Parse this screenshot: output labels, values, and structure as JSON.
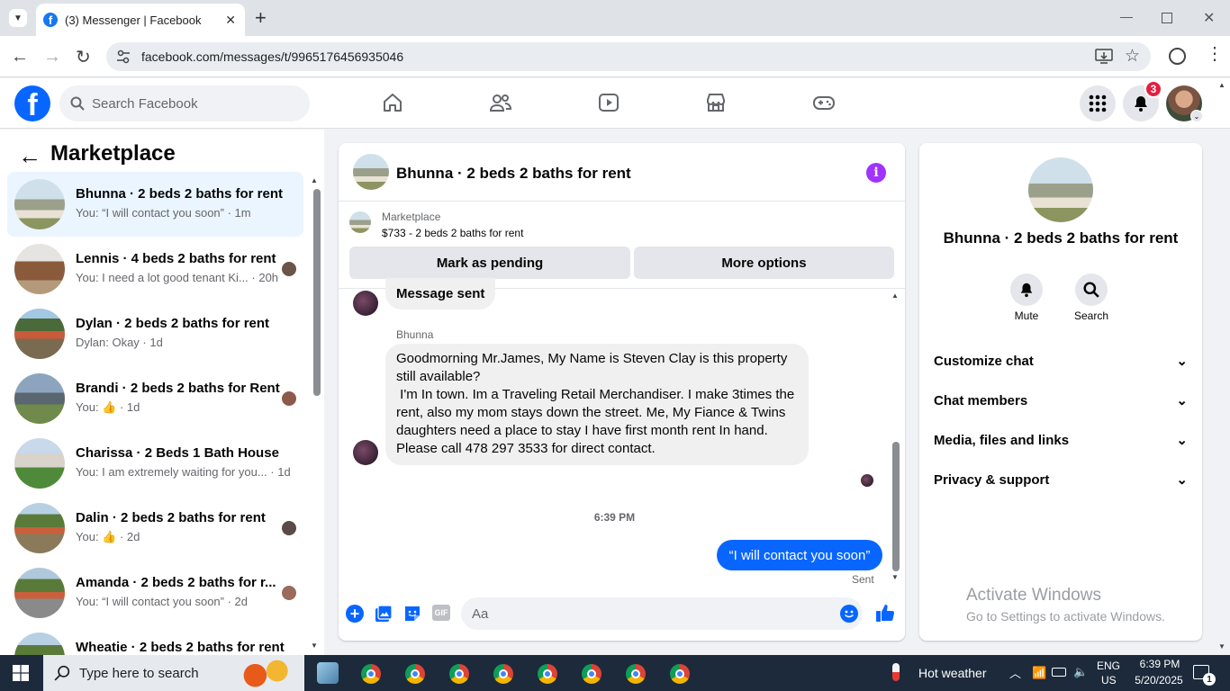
{
  "browser": {
    "tab_title": "(3) Messenger | Facebook",
    "url": "facebook.com/messages/t/9965176456935046"
  },
  "fb_header": {
    "search_placeholder": "Search Facebook",
    "notification_count": "3"
  },
  "left_panel": {
    "title": "Marketplace",
    "threads": [
      {
        "name": "Bhunna · 2 beds 2 baths for rent",
        "preview": "You: “I will contact you soon” · 1m",
        "active": true
      },
      {
        "name": "Lennis · 4 beds 2 baths for rent",
        "preview": "You: I need a lot good tenant Ki... · 20h"
      },
      {
        "name": "Dylan · 2 beds 2 baths for rent",
        "preview": "Dylan: Okay · 1d"
      },
      {
        "name": "Brandi · 2 beds 2 baths for Rent",
        "preview": "You: 👍 · 1d"
      },
      {
        "name": "Charissa · 2 Beds 1 Bath House",
        "preview": "You: I am extremely waiting for you... · 1d"
      },
      {
        "name": "Dalin · 2 beds 2 baths for rent",
        "preview": "You: 👍 · 2d"
      },
      {
        "name": "Amanda · 2 beds 2 baths for r...",
        "preview": "You: “I will contact you soon” · 2d"
      },
      {
        "name": "Wheatie · 2 beds 2 baths for rent",
        "preview": ""
      }
    ]
  },
  "chat": {
    "title": "Bhunna · 2 beds 2 baths for rent",
    "listing_source": "Marketplace",
    "listing_desc": "$733 - 2 beds 2 baths for rent",
    "mark_pending": "Mark as pending",
    "more_options": "More options",
    "msg_prev": "Message sent",
    "sender": "Bhunna",
    "msg_main": "Goodmorning Mr.James, My Name is Steven Clay is this property still available?\n I'm In town. Im a Traveling Retail Merchandiser. I make 3times the rent, also my mom stays down the street. Me, My Fiance & Twins daughters need a place to stay I have first month rent In hand. Please call 478 297 3533 for direct contact.",
    "timestamp": "6:39 PM",
    "my_msg": "“I will contact you soon”",
    "sent_status": "Sent",
    "composer_placeholder": "Aa"
  },
  "info_panel": {
    "title": "Bhunna · 2 beds 2 baths for rent",
    "mute": "Mute",
    "search": "Search",
    "rows": [
      "Customize chat",
      "Chat members",
      "Media, files and links",
      "Privacy & support"
    ],
    "activate_title": "Activate Windows",
    "activate_sub": "Go to Settings to activate Windows."
  },
  "taskbar": {
    "search_placeholder": "Type here to search",
    "weather": "Hot weather",
    "lang1": "ENG",
    "lang2": "US",
    "time": "6:39 PM",
    "date": "5/20/2025",
    "notif_count": "1"
  }
}
